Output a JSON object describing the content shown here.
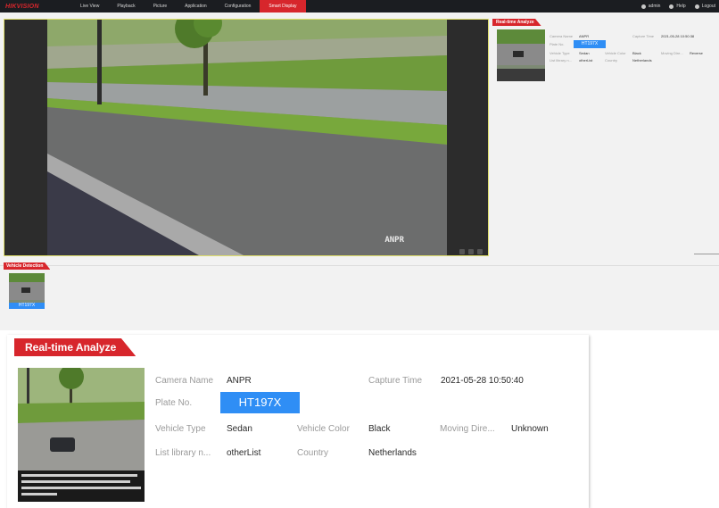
{
  "brand": "HIKVISION",
  "nav": {
    "items": [
      "Live View",
      "Playback",
      "Picture",
      "Application",
      "Configuration",
      "Smart Display"
    ],
    "active": "Smart Display"
  },
  "user": {
    "name": "admin",
    "help": "Help",
    "logout": "Logout"
  },
  "video": {
    "overlay": "ANPR"
  },
  "realtime": {
    "title": "Real-time Analyze",
    "camera_name_label": "Camera Name",
    "camera_name": "ANPR",
    "capture_time_label": "Capture Time",
    "capture_time": "2021-05-28 10:50:40",
    "plate_label": "Plate No.",
    "plate": "HT197X",
    "vehicle_type_label": "Vehicle Type",
    "vehicle_type": "Sedan",
    "vehicle_color_label": "Vehicle Color",
    "vehicle_color": "Black",
    "moving_dir_label": "Moving Dire...",
    "moving_dir": "Unknown",
    "list_library_label": "List library n...",
    "list_library": "otherList",
    "country_label": "Country",
    "country": "Netherlands"
  },
  "realtime_small": {
    "title": "Real-time Analyze",
    "camera_name_label": "Camera Name",
    "camera_name": "ANPR",
    "capture_time_label": "Capture Time",
    "capture_time": "2021-05-28 10:50:38",
    "plate_label": "Plate No.",
    "plate": "HT197X",
    "vehicle_type_label": "Vehicle Type",
    "vehicle_type": "Sedan",
    "vehicle_color_label": "Vehicle Color",
    "vehicle_color": "Black",
    "moving_dir_label": "Moving Dire...",
    "moving_dir": "Reverse",
    "list_library_label": "List library n...",
    "list_library": "otherList",
    "country_label": "Country",
    "country": "Netherlands"
  },
  "vehicle_detection": {
    "title": "Vehicle Detection",
    "plate": "HT197X"
  },
  "colors": {
    "accent": "#d7262c",
    "plate_bg": "#2f8ef5",
    "topbar": "#1b1d21"
  }
}
